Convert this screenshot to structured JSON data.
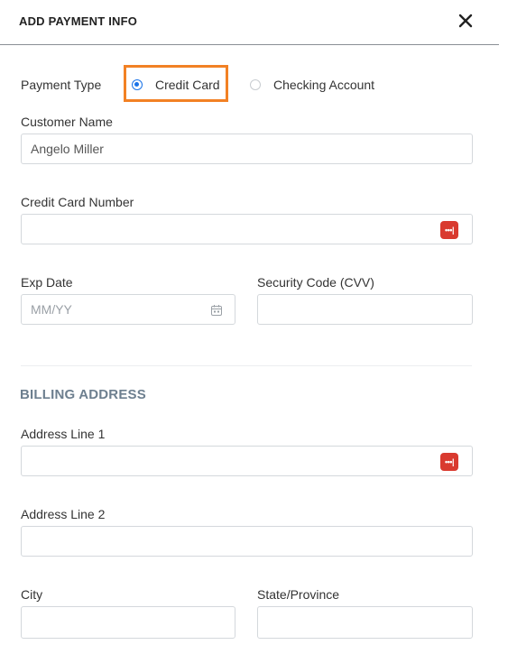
{
  "header": {
    "title": "ADD PAYMENT INFO",
    "close_icon": "close-icon"
  },
  "payment_type": {
    "label": "Payment Type",
    "options": [
      {
        "label": "Credit Card",
        "selected": true
      },
      {
        "label": "Checking Account",
        "selected": false
      }
    ],
    "highlight_color": "#f28124",
    "accent_color": "#1a73e8"
  },
  "customer_name": {
    "label": "Customer Name",
    "value": "Angelo Miller"
  },
  "credit_card_number": {
    "label": "Credit Card Number",
    "value": "",
    "icon": "password-manager-icon"
  },
  "exp_date": {
    "label": "Exp Date",
    "placeholder": "MM/YY",
    "icon": "calendar-icon"
  },
  "security_code": {
    "label": "Security Code (CVV)",
    "value": ""
  },
  "billing": {
    "title": "BILLING ADDRESS",
    "address1": {
      "label": "Address Line 1",
      "value": "",
      "icon": "password-manager-icon"
    },
    "address2": {
      "label": "Address Line 2",
      "value": ""
    },
    "city": {
      "label": "City",
      "value": ""
    },
    "state": {
      "label": "State/Province",
      "value": ""
    }
  },
  "password_icon_glyph": "•••|"
}
